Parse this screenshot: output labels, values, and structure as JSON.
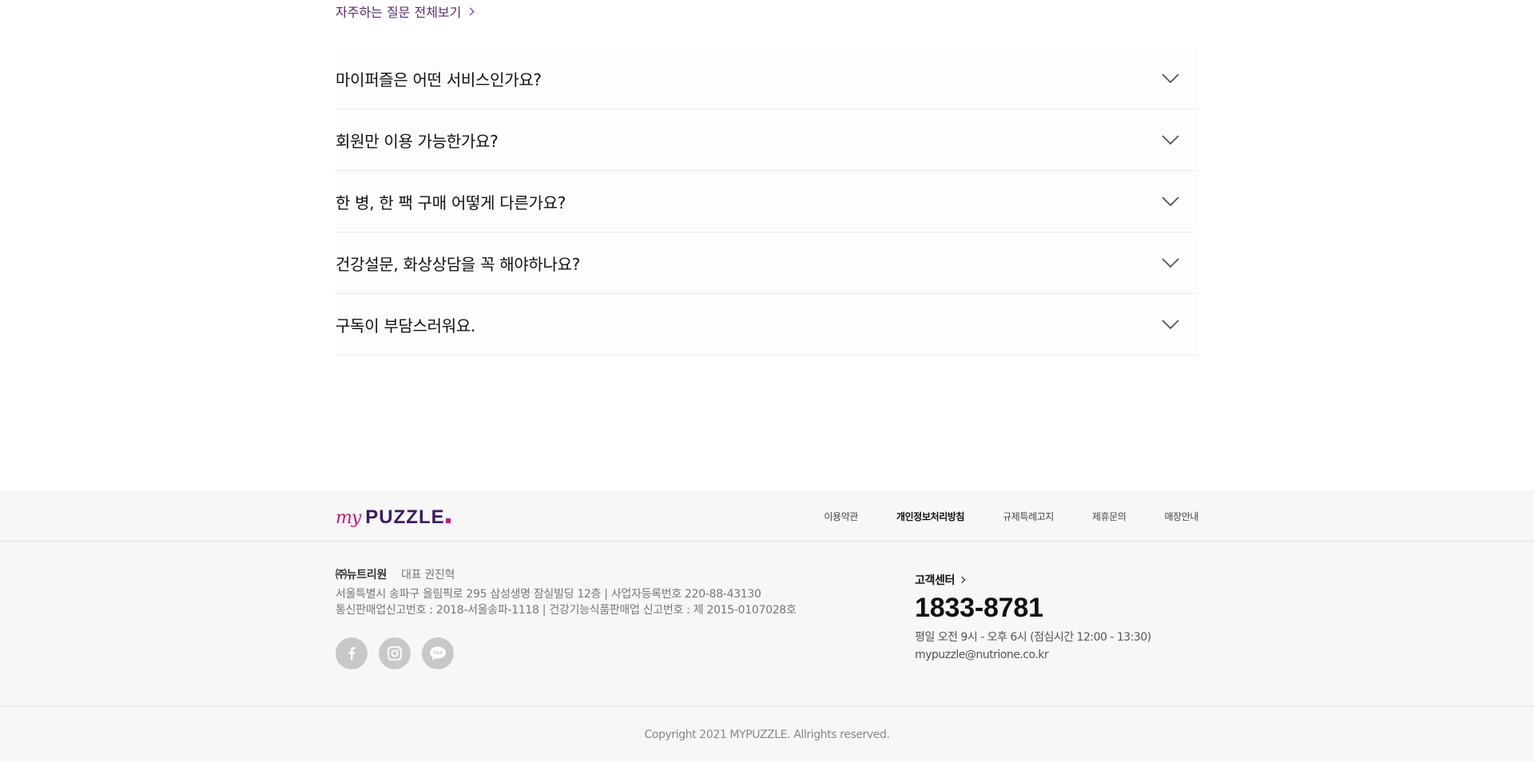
{
  "faq": {
    "all_link": "자주하는 질문 전체보기",
    "items": [
      {
        "question": "마이퍼즐은 어떤 서비스인가요?"
      },
      {
        "question": "회원만 이용 가능한가요?"
      },
      {
        "question": "한 병, 한 팩 구매 어떻게 다른가요?"
      },
      {
        "question": "건강설문, 화상상담을 꼭 해야하나요?"
      },
      {
        "question": "구독이 부담스러워요."
      }
    ]
  },
  "footer": {
    "logo": {
      "my": "my",
      "puzzle": "PUZZLE"
    },
    "nav": [
      {
        "label": "이용약관"
      },
      {
        "label": "개인정보처리방침"
      },
      {
        "label": "규제특례고지"
      },
      {
        "label": "제휴문의"
      },
      {
        "label": "매장안내"
      }
    ],
    "company": {
      "name": "㈜뉴트리원",
      "ceo": "대표 권진혁",
      "address_line": "서울특별시 송파구 올림픽로 295 삼성생명 잠실빌딩 12층 | 사업자등록번호 220-88-43130",
      "registration_line": "통신판매업신고번호 : 2018-서울송파-1118 | 건강기능식품판매업 신고번호 : 제 2015-0107028호"
    },
    "socials": [
      {
        "icon": "facebook-icon"
      },
      {
        "icon": "instagram-icon"
      },
      {
        "icon": "kakaotalk-icon",
        "label": "TALK"
      }
    ],
    "customer_center": {
      "title": "고객센터",
      "phone": "1833-8781",
      "hours": "평일 오전 9시 - 오후 6시 (점심시간 12:00 - 13:30)",
      "email": "mypuzzle@nutrione.co.kr"
    },
    "copyright": "Copyright 2021 MYPUZZLE. Allrights reserved."
  },
  "colors": {
    "accent_purple": "#5b2a6e",
    "brand_pink": "#c2187a",
    "brand_navy": "#3a1c63",
    "footer_bg": "#f7f7f7"
  }
}
